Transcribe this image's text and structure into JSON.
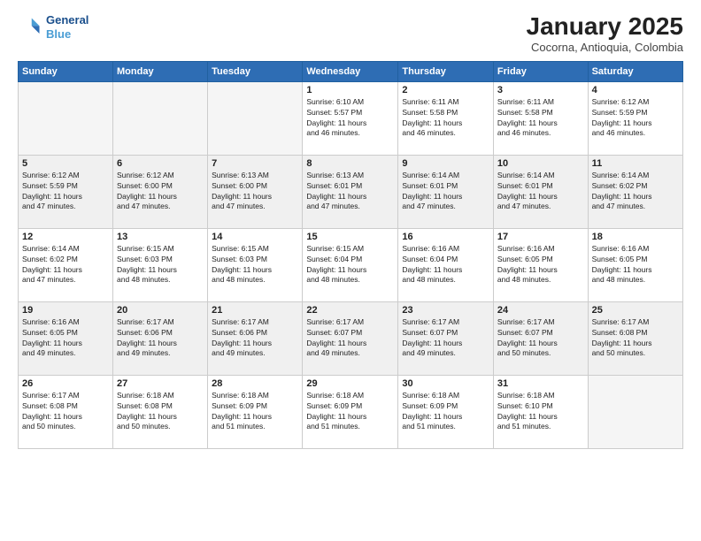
{
  "header": {
    "logo_line1": "General",
    "logo_line2": "Blue",
    "title": "January 2025",
    "subtitle": "Cocorna, Antioquia, Colombia"
  },
  "weekdays": [
    "Sunday",
    "Monday",
    "Tuesday",
    "Wednesday",
    "Thursday",
    "Friday",
    "Saturday"
  ],
  "weeks": [
    [
      {
        "day": "",
        "info": ""
      },
      {
        "day": "",
        "info": ""
      },
      {
        "day": "",
        "info": ""
      },
      {
        "day": "1",
        "info": "Sunrise: 6:10 AM\nSunset: 5:57 PM\nDaylight: 11 hours\nand 46 minutes."
      },
      {
        "day": "2",
        "info": "Sunrise: 6:11 AM\nSunset: 5:58 PM\nDaylight: 11 hours\nand 46 minutes."
      },
      {
        "day": "3",
        "info": "Sunrise: 6:11 AM\nSunset: 5:58 PM\nDaylight: 11 hours\nand 46 minutes."
      },
      {
        "day": "4",
        "info": "Sunrise: 6:12 AM\nSunset: 5:59 PM\nDaylight: 11 hours\nand 46 minutes."
      }
    ],
    [
      {
        "day": "5",
        "info": "Sunrise: 6:12 AM\nSunset: 5:59 PM\nDaylight: 11 hours\nand 47 minutes."
      },
      {
        "day": "6",
        "info": "Sunrise: 6:12 AM\nSunset: 6:00 PM\nDaylight: 11 hours\nand 47 minutes."
      },
      {
        "day": "7",
        "info": "Sunrise: 6:13 AM\nSunset: 6:00 PM\nDaylight: 11 hours\nand 47 minutes."
      },
      {
        "day": "8",
        "info": "Sunrise: 6:13 AM\nSunset: 6:01 PM\nDaylight: 11 hours\nand 47 minutes."
      },
      {
        "day": "9",
        "info": "Sunrise: 6:14 AM\nSunset: 6:01 PM\nDaylight: 11 hours\nand 47 minutes."
      },
      {
        "day": "10",
        "info": "Sunrise: 6:14 AM\nSunset: 6:01 PM\nDaylight: 11 hours\nand 47 minutes."
      },
      {
        "day": "11",
        "info": "Sunrise: 6:14 AM\nSunset: 6:02 PM\nDaylight: 11 hours\nand 47 minutes."
      }
    ],
    [
      {
        "day": "12",
        "info": "Sunrise: 6:14 AM\nSunset: 6:02 PM\nDaylight: 11 hours\nand 47 minutes."
      },
      {
        "day": "13",
        "info": "Sunrise: 6:15 AM\nSunset: 6:03 PM\nDaylight: 11 hours\nand 48 minutes."
      },
      {
        "day": "14",
        "info": "Sunrise: 6:15 AM\nSunset: 6:03 PM\nDaylight: 11 hours\nand 48 minutes."
      },
      {
        "day": "15",
        "info": "Sunrise: 6:15 AM\nSunset: 6:04 PM\nDaylight: 11 hours\nand 48 minutes."
      },
      {
        "day": "16",
        "info": "Sunrise: 6:16 AM\nSunset: 6:04 PM\nDaylight: 11 hours\nand 48 minutes."
      },
      {
        "day": "17",
        "info": "Sunrise: 6:16 AM\nSunset: 6:05 PM\nDaylight: 11 hours\nand 48 minutes."
      },
      {
        "day": "18",
        "info": "Sunrise: 6:16 AM\nSunset: 6:05 PM\nDaylight: 11 hours\nand 48 minutes."
      }
    ],
    [
      {
        "day": "19",
        "info": "Sunrise: 6:16 AM\nSunset: 6:05 PM\nDaylight: 11 hours\nand 49 minutes."
      },
      {
        "day": "20",
        "info": "Sunrise: 6:17 AM\nSunset: 6:06 PM\nDaylight: 11 hours\nand 49 minutes."
      },
      {
        "day": "21",
        "info": "Sunrise: 6:17 AM\nSunset: 6:06 PM\nDaylight: 11 hours\nand 49 minutes."
      },
      {
        "day": "22",
        "info": "Sunrise: 6:17 AM\nSunset: 6:07 PM\nDaylight: 11 hours\nand 49 minutes."
      },
      {
        "day": "23",
        "info": "Sunrise: 6:17 AM\nSunset: 6:07 PM\nDaylight: 11 hours\nand 49 minutes."
      },
      {
        "day": "24",
        "info": "Sunrise: 6:17 AM\nSunset: 6:07 PM\nDaylight: 11 hours\nand 50 minutes."
      },
      {
        "day": "25",
        "info": "Sunrise: 6:17 AM\nSunset: 6:08 PM\nDaylight: 11 hours\nand 50 minutes."
      }
    ],
    [
      {
        "day": "26",
        "info": "Sunrise: 6:17 AM\nSunset: 6:08 PM\nDaylight: 11 hours\nand 50 minutes."
      },
      {
        "day": "27",
        "info": "Sunrise: 6:18 AM\nSunset: 6:08 PM\nDaylight: 11 hours\nand 50 minutes."
      },
      {
        "day": "28",
        "info": "Sunrise: 6:18 AM\nSunset: 6:09 PM\nDaylight: 11 hours\nand 51 minutes."
      },
      {
        "day": "29",
        "info": "Sunrise: 6:18 AM\nSunset: 6:09 PM\nDaylight: 11 hours\nand 51 minutes."
      },
      {
        "day": "30",
        "info": "Sunrise: 6:18 AM\nSunset: 6:09 PM\nDaylight: 11 hours\nand 51 minutes."
      },
      {
        "day": "31",
        "info": "Sunrise: 6:18 AM\nSunset: 6:10 PM\nDaylight: 11 hours\nand 51 minutes."
      },
      {
        "day": "",
        "info": ""
      }
    ]
  ]
}
